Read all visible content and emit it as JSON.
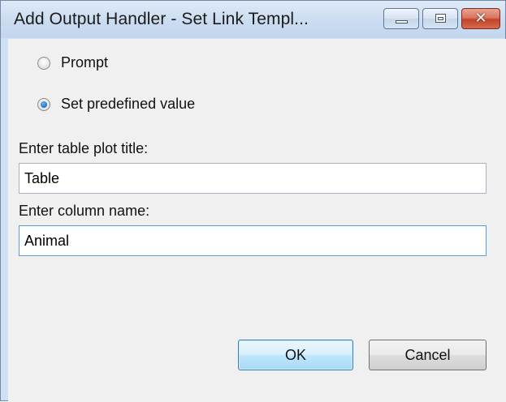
{
  "window": {
    "title": "Add Output Handler - Set Link Templ...",
    "minimize_icon": "minimize-icon",
    "maximize_icon": "maximize-icon",
    "close_icon": "close-icon",
    "close_glyph": "✕"
  },
  "options": {
    "prompt_label": "Prompt",
    "prompt_checked": false,
    "predefined_label": "Set predefined value",
    "predefined_checked": true
  },
  "fields": {
    "title_label": "Enter table plot title:",
    "title_value": "Table",
    "column_label": "Enter column name:",
    "column_value": "Animal"
  },
  "buttons": {
    "ok_label": "OK",
    "cancel_label": "Cancel"
  },
  "colors": {
    "titlebar": "#cbdcf0",
    "client": "#f0f0f0",
    "close_button": "#c2432a",
    "default_button_border": "#3c7fb1",
    "focus_border": "#5b9bd8"
  }
}
